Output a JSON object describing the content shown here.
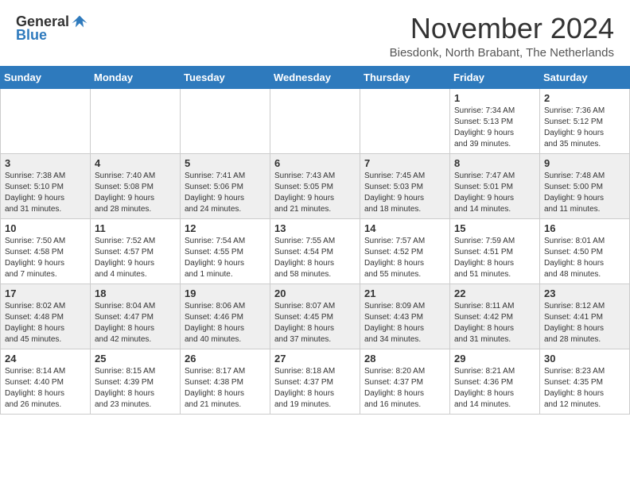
{
  "header": {
    "logo_general": "General",
    "logo_blue": "Blue",
    "month_title": "November 2024",
    "location": "Biesdonk, North Brabant, The Netherlands"
  },
  "days_of_week": [
    "Sunday",
    "Monday",
    "Tuesday",
    "Wednesday",
    "Thursday",
    "Friday",
    "Saturday"
  ],
  "weeks": [
    [
      {
        "day": "",
        "info": ""
      },
      {
        "day": "",
        "info": ""
      },
      {
        "day": "",
        "info": ""
      },
      {
        "day": "",
        "info": ""
      },
      {
        "day": "",
        "info": ""
      },
      {
        "day": "1",
        "info": "Sunrise: 7:34 AM\nSunset: 5:13 PM\nDaylight: 9 hours\nand 39 minutes."
      },
      {
        "day": "2",
        "info": "Sunrise: 7:36 AM\nSunset: 5:12 PM\nDaylight: 9 hours\nand 35 minutes."
      }
    ],
    [
      {
        "day": "3",
        "info": "Sunrise: 7:38 AM\nSunset: 5:10 PM\nDaylight: 9 hours\nand 31 minutes."
      },
      {
        "day": "4",
        "info": "Sunrise: 7:40 AM\nSunset: 5:08 PM\nDaylight: 9 hours\nand 28 minutes."
      },
      {
        "day": "5",
        "info": "Sunrise: 7:41 AM\nSunset: 5:06 PM\nDaylight: 9 hours\nand 24 minutes."
      },
      {
        "day": "6",
        "info": "Sunrise: 7:43 AM\nSunset: 5:05 PM\nDaylight: 9 hours\nand 21 minutes."
      },
      {
        "day": "7",
        "info": "Sunrise: 7:45 AM\nSunset: 5:03 PM\nDaylight: 9 hours\nand 18 minutes."
      },
      {
        "day": "8",
        "info": "Sunrise: 7:47 AM\nSunset: 5:01 PM\nDaylight: 9 hours\nand 14 minutes."
      },
      {
        "day": "9",
        "info": "Sunrise: 7:48 AM\nSunset: 5:00 PM\nDaylight: 9 hours\nand 11 minutes."
      }
    ],
    [
      {
        "day": "10",
        "info": "Sunrise: 7:50 AM\nSunset: 4:58 PM\nDaylight: 9 hours\nand 7 minutes."
      },
      {
        "day": "11",
        "info": "Sunrise: 7:52 AM\nSunset: 4:57 PM\nDaylight: 9 hours\nand 4 minutes."
      },
      {
        "day": "12",
        "info": "Sunrise: 7:54 AM\nSunset: 4:55 PM\nDaylight: 9 hours\nand 1 minute."
      },
      {
        "day": "13",
        "info": "Sunrise: 7:55 AM\nSunset: 4:54 PM\nDaylight: 8 hours\nand 58 minutes."
      },
      {
        "day": "14",
        "info": "Sunrise: 7:57 AM\nSunset: 4:52 PM\nDaylight: 8 hours\nand 55 minutes."
      },
      {
        "day": "15",
        "info": "Sunrise: 7:59 AM\nSunset: 4:51 PM\nDaylight: 8 hours\nand 51 minutes."
      },
      {
        "day": "16",
        "info": "Sunrise: 8:01 AM\nSunset: 4:50 PM\nDaylight: 8 hours\nand 48 minutes."
      }
    ],
    [
      {
        "day": "17",
        "info": "Sunrise: 8:02 AM\nSunset: 4:48 PM\nDaylight: 8 hours\nand 45 minutes."
      },
      {
        "day": "18",
        "info": "Sunrise: 8:04 AM\nSunset: 4:47 PM\nDaylight: 8 hours\nand 42 minutes."
      },
      {
        "day": "19",
        "info": "Sunrise: 8:06 AM\nSunset: 4:46 PM\nDaylight: 8 hours\nand 40 minutes."
      },
      {
        "day": "20",
        "info": "Sunrise: 8:07 AM\nSunset: 4:45 PM\nDaylight: 8 hours\nand 37 minutes."
      },
      {
        "day": "21",
        "info": "Sunrise: 8:09 AM\nSunset: 4:43 PM\nDaylight: 8 hours\nand 34 minutes."
      },
      {
        "day": "22",
        "info": "Sunrise: 8:11 AM\nSunset: 4:42 PM\nDaylight: 8 hours\nand 31 minutes."
      },
      {
        "day": "23",
        "info": "Sunrise: 8:12 AM\nSunset: 4:41 PM\nDaylight: 8 hours\nand 28 minutes."
      }
    ],
    [
      {
        "day": "24",
        "info": "Sunrise: 8:14 AM\nSunset: 4:40 PM\nDaylight: 8 hours\nand 26 minutes."
      },
      {
        "day": "25",
        "info": "Sunrise: 8:15 AM\nSunset: 4:39 PM\nDaylight: 8 hours\nand 23 minutes."
      },
      {
        "day": "26",
        "info": "Sunrise: 8:17 AM\nSunset: 4:38 PM\nDaylight: 8 hours\nand 21 minutes."
      },
      {
        "day": "27",
        "info": "Sunrise: 8:18 AM\nSunset: 4:37 PM\nDaylight: 8 hours\nand 19 minutes."
      },
      {
        "day": "28",
        "info": "Sunrise: 8:20 AM\nSunset: 4:37 PM\nDaylight: 8 hours\nand 16 minutes."
      },
      {
        "day": "29",
        "info": "Sunrise: 8:21 AM\nSunset: 4:36 PM\nDaylight: 8 hours\nand 14 minutes."
      },
      {
        "day": "30",
        "info": "Sunrise: 8:23 AM\nSunset: 4:35 PM\nDaylight: 8 hours\nand 12 minutes."
      }
    ]
  ]
}
